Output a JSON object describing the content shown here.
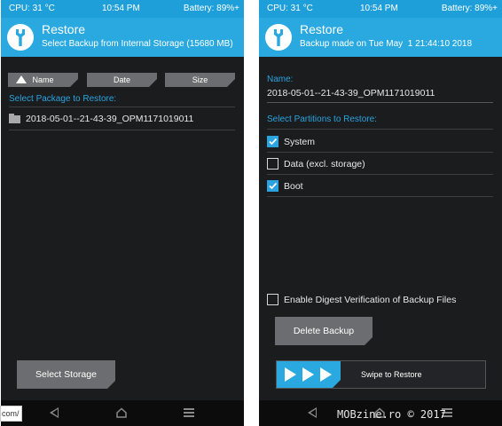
{
  "left_screen": {
    "status": {
      "cpu": "CPU: 31 °C",
      "time": "10:54 PM",
      "battery": "Battery: 89%+"
    },
    "header": {
      "title": "Restore",
      "subtitle": "Select Backup from Internal Storage (15680 MB)"
    },
    "sort_buttons": [
      "Name",
      "Date",
      "Size"
    ],
    "section_label": "Select Package to Restore:",
    "packages": [
      "2018-05-01--21-43-39_OPM1171019011"
    ],
    "select_storage_label": "Select Storage",
    "url_fragment": "com/",
    "nav_icons": [
      "back-icon",
      "home-icon",
      "menu-icon"
    ]
  },
  "right_screen": {
    "status": {
      "cpu": "CPU: 31 °C",
      "time": "10:54 PM",
      "battery": "Battery: 89%+"
    },
    "header": {
      "title": "Restore",
      "subtitle": "Backup made on Tue May  1 21:44:10 2018"
    },
    "name_label": "Name:",
    "name_value": "2018-05-01--21-43-39_OPM1171019011",
    "partitions_label": "Select Partitions to Restore:",
    "partitions": [
      {
        "label": "System",
        "checked": true
      },
      {
        "label": "Data (excl. storage)",
        "checked": false
      },
      {
        "label": "Boot",
        "checked": true
      }
    ],
    "digest_label": "Enable Digest Verification of Backup Files",
    "digest_checked": false,
    "delete_label": "Delete Backup",
    "swipe_label": "Swipe to Restore",
    "nav_icons": [
      "back-icon",
      "home-icon",
      "menu-icon"
    ]
  },
  "watermark": "MOBzine.ro © 2017",
  "colors": {
    "accent": "#2aa9e0",
    "statusbar": "#1e9fd9",
    "background": "#1b1c1e",
    "button": "#6c6d70",
    "label": "#2aa3df"
  }
}
